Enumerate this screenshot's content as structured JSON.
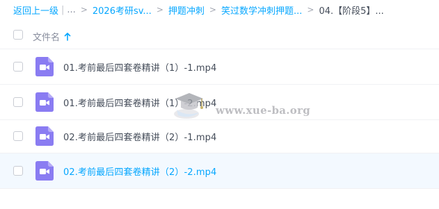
{
  "breadcrumb": {
    "back": "返回上一级",
    "ellipsis": "...",
    "items": [
      "2026考研sv...",
      "押题冲刺",
      "笑过数学冲刺押题...",
      "04.【阶段5】..."
    ]
  },
  "header": {
    "column_label": "文件名",
    "sort_icon": "arrow-up-icon"
  },
  "files": [
    {
      "name": "01.考前最后四套卷精讲（1）-1.mp4",
      "icon": "video-file-icon"
    },
    {
      "name": "01.考前最后四套卷精讲（1）-2.mp4",
      "icon": "video-file-icon"
    },
    {
      "name": "02.考前最后四套卷精讲（2）-1.mp4",
      "icon": "video-file-icon"
    },
    {
      "name": "02.考前最后四套卷精讲（2）-2.mp4",
      "icon": "video-file-icon"
    }
  ],
  "watermark": {
    "text": "www.xue-ba.org"
  },
  "colors": {
    "accent": "#06a7ff",
    "video_icon": "#8a7cf2",
    "hover_row": "#f3f9ff"
  }
}
